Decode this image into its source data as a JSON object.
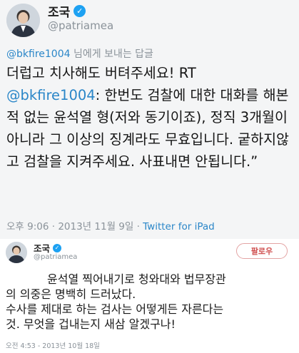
{
  "tweet1": {
    "display_name": "조국",
    "handle": "@patriamea",
    "reply_to": {
      "handle": "@bkfire1004",
      "suffix": " 님에게 보내는 답글"
    },
    "body": {
      "part1": "더럽고 치사해도 버텨주세요! RT",
      "mention": "@bkfire1004",
      "part2": ": 한번도 검찰에 대한 대화를 해본적 없는 윤석열 형(저와 동기이죠), 정직 3개월이 아니라 그 이상의 징계라도 무효입니다. 궅하지않고 검찰을 지켜주세요. 사표내면 안됩니다.”"
    },
    "timestamp": "오후 9:06 · 2013년 11월 9일 · ",
    "source": "Twitter for iPad"
  },
  "tweet2": {
    "display_name": "조국",
    "handle": "@patriamea",
    "follow_label": "팔로우",
    "lines": [
      "윤석열 찍어내기로 청와대와 법무장관",
      "의 의중은 명백히 드러났다.",
      "수사를 제대로 하는 검사는 어떻게든 자른다는",
      "것. 무엇을 겁내는지 새삼 알겠구나!"
    ],
    "timestamp": "오전 4:53 - 2013년 10월 18일"
  },
  "colors": {
    "verified": "#1da1f2",
    "mention": "#2a86c8",
    "follow": "#d05050"
  }
}
